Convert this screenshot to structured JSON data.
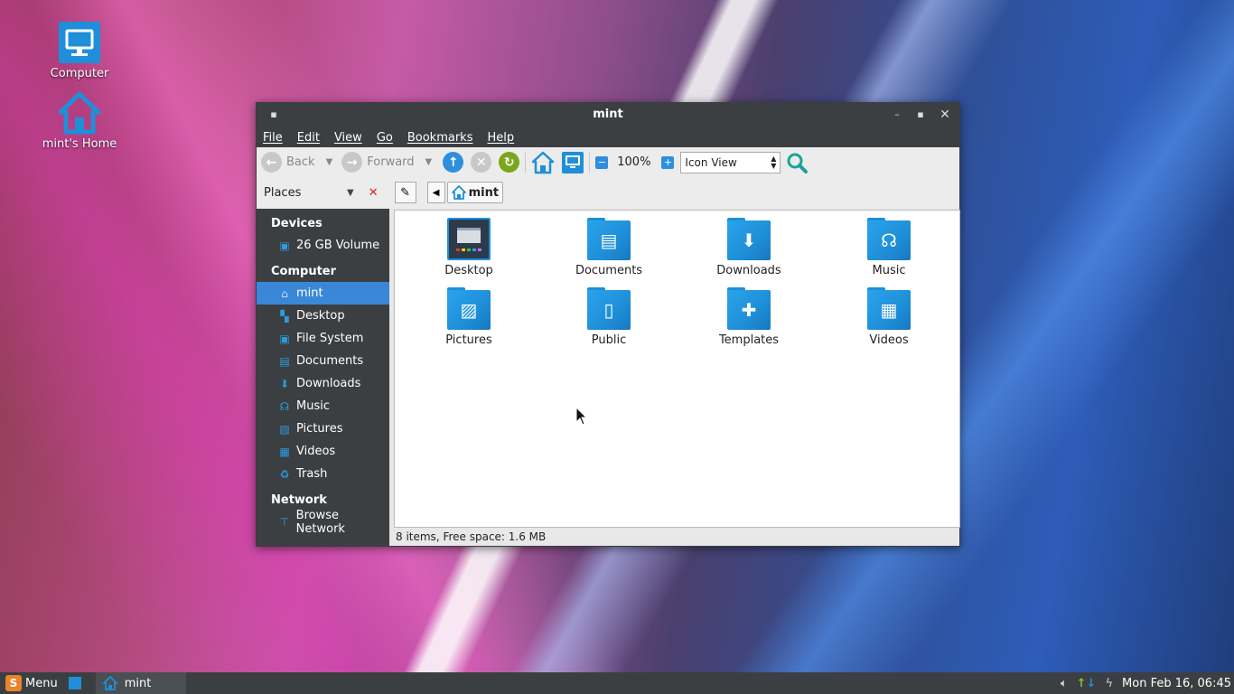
{
  "desktop": {
    "icons": [
      {
        "label": "Computer",
        "icon": "monitor-icon"
      },
      {
        "label": "mint's Home",
        "icon": "home-icon"
      }
    ]
  },
  "window": {
    "title": "mint",
    "menu": [
      "File",
      "Edit",
      "View",
      "Go",
      "Bookmarks",
      "Help"
    ],
    "toolbar": {
      "back_label": "Back",
      "forward_label": "Forward",
      "zoom_level": "100%",
      "view_mode": "Icon View"
    },
    "sidebar_mode": "Places",
    "breadcrumb": "mint",
    "sidebar": {
      "devices_heading": "Devices",
      "devices": [
        {
          "label": "26 GB Volume",
          "icon": "drive-icon"
        }
      ],
      "computer_heading": "Computer",
      "computer": [
        {
          "label": "mint",
          "icon": "home-icon"
        },
        {
          "label": "Desktop",
          "icon": "desktop-icon"
        },
        {
          "label": "File System",
          "icon": "drive-icon"
        },
        {
          "label": "Documents",
          "icon": "document-icon"
        },
        {
          "label": "Downloads",
          "icon": "download-icon"
        },
        {
          "label": "Music",
          "icon": "headphones-icon"
        },
        {
          "label": "Pictures",
          "icon": "picture-icon"
        },
        {
          "label": "Videos",
          "icon": "film-icon"
        },
        {
          "label": "Trash",
          "icon": "trash-icon"
        }
      ],
      "network_heading": "Network",
      "network": [
        {
          "label": "Browse Network",
          "icon": "network-icon"
        }
      ]
    },
    "files": [
      {
        "label": "Desktop",
        "icon": "desktop-folder-icon"
      },
      {
        "label": "Documents",
        "icon": "document-icon"
      },
      {
        "label": "Downloads",
        "icon": "download-icon"
      },
      {
        "label": "Music",
        "icon": "headphones-icon"
      },
      {
        "label": "Pictures",
        "icon": "picture-icon"
      },
      {
        "label": "Public",
        "icon": "door-icon"
      },
      {
        "label": "Templates",
        "icon": "puzzle-icon"
      },
      {
        "label": "Videos",
        "icon": "film-icon"
      }
    ],
    "status": "8 items, Free space: 1.6 MB"
  },
  "taskbar": {
    "menu_label": "Menu",
    "task_label": "mint",
    "clock": "Mon Feb 16, 06:45"
  },
  "colors": {
    "accent": "#3a87d8",
    "folder": "#1e8fd8",
    "panel": "#3b3f42"
  }
}
